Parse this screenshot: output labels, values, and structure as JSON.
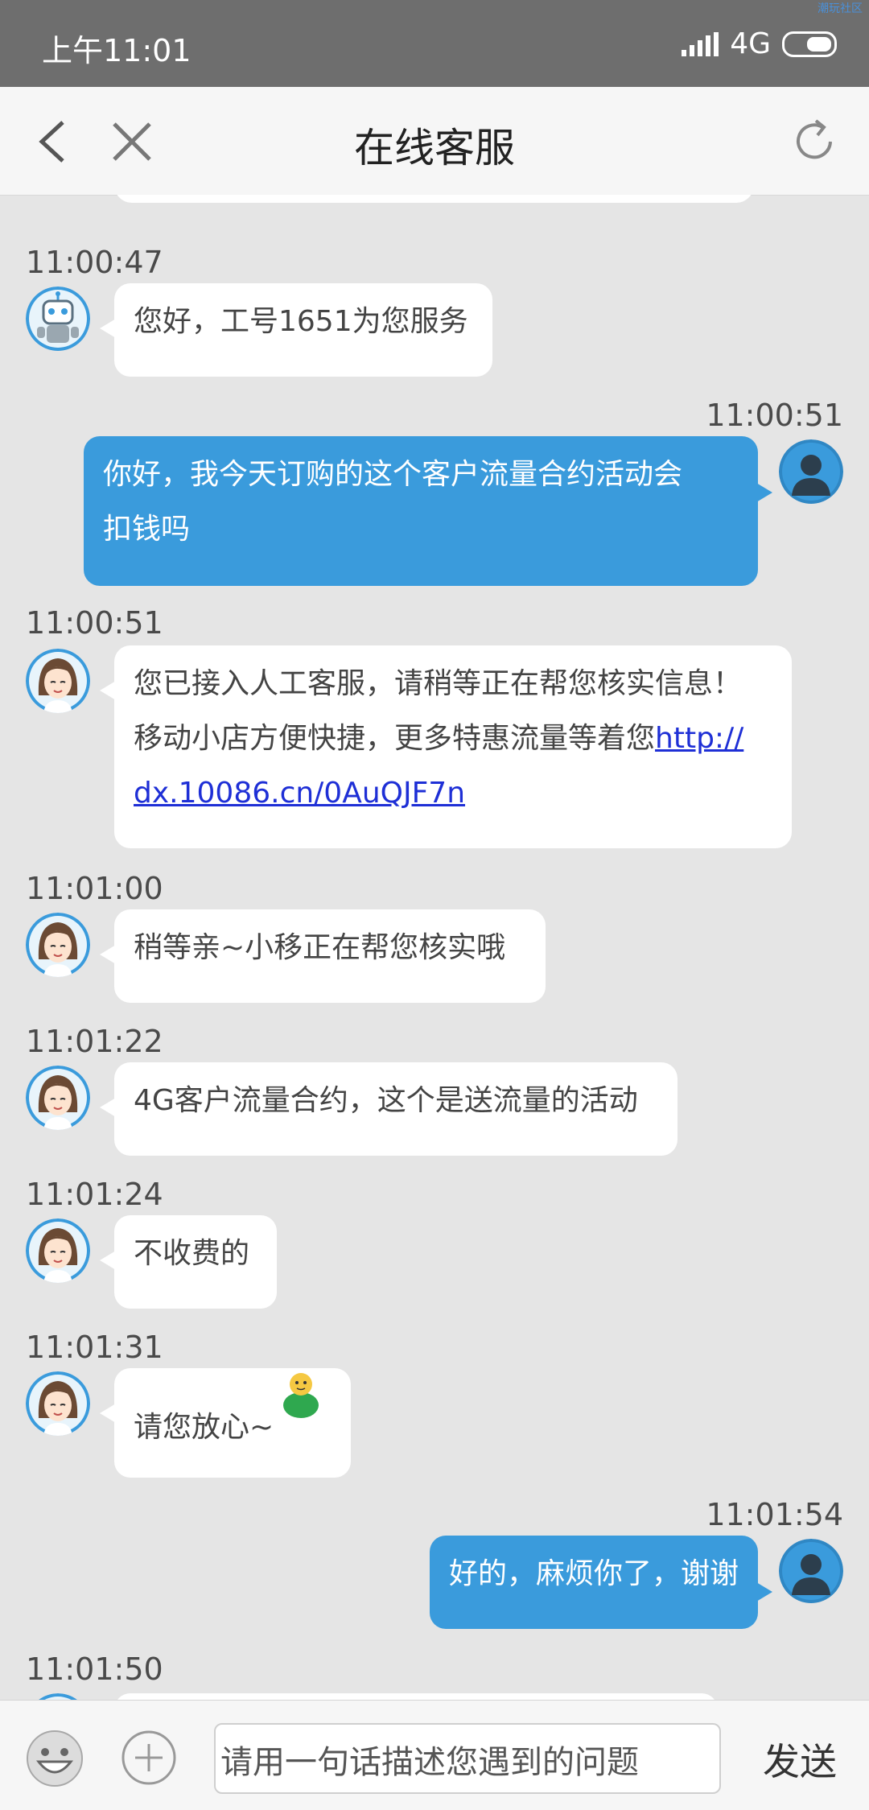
{
  "status_bar": {
    "time": "上午11:01",
    "network": "4G",
    "watermark": "潮玩社区"
  },
  "header": {
    "title": "在线客服"
  },
  "messages": [
    {
      "time": "11:00:47",
      "sender": "agent-bot",
      "text": "您好，工号1651为您服务"
    },
    {
      "time": "11:00:51",
      "sender": "user",
      "line1": "你好，我今天订购的这个客户流量合约活动会",
      "line2": "扣钱吗"
    },
    {
      "time": "11:00:51",
      "sender": "agent",
      "line1": "您已接入人工客服，请稍等正在帮您核实信息！",
      "line2": "移动小店方便快捷，更多特惠流量等着您",
      "link_part1": "http://",
      "link_part2": "dx.10086.cn/0AuQJF7n"
    },
    {
      "time": "11:01:00",
      "sender": "agent",
      "text": "稍等亲~小移正在帮您核实哦"
    },
    {
      "time": "11:01:22",
      "sender": "agent",
      "text": "4G客户流量合约，这个是送流量的活动"
    },
    {
      "time": "11:01:24",
      "sender": "agent",
      "text": "不收费的"
    },
    {
      "time": "11:01:31",
      "sender": "agent",
      "text": "请您放心~"
    },
    {
      "time": "11:01:54",
      "sender": "user",
      "text": "好的，麻烦你了，谢谢"
    },
    {
      "time": "11:01:50",
      "sender": "agent",
      "text": ""
    }
  ],
  "input_bar": {
    "placeholder": "请用一句话描述您遇到的问题",
    "send_label": "发送"
  },
  "colors": {
    "user_bubble": "#3a9bdc",
    "agent_bubble": "#ffffff",
    "chat_background": "#e5e5e5",
    "link": "#1e2fd6"
  }
}
